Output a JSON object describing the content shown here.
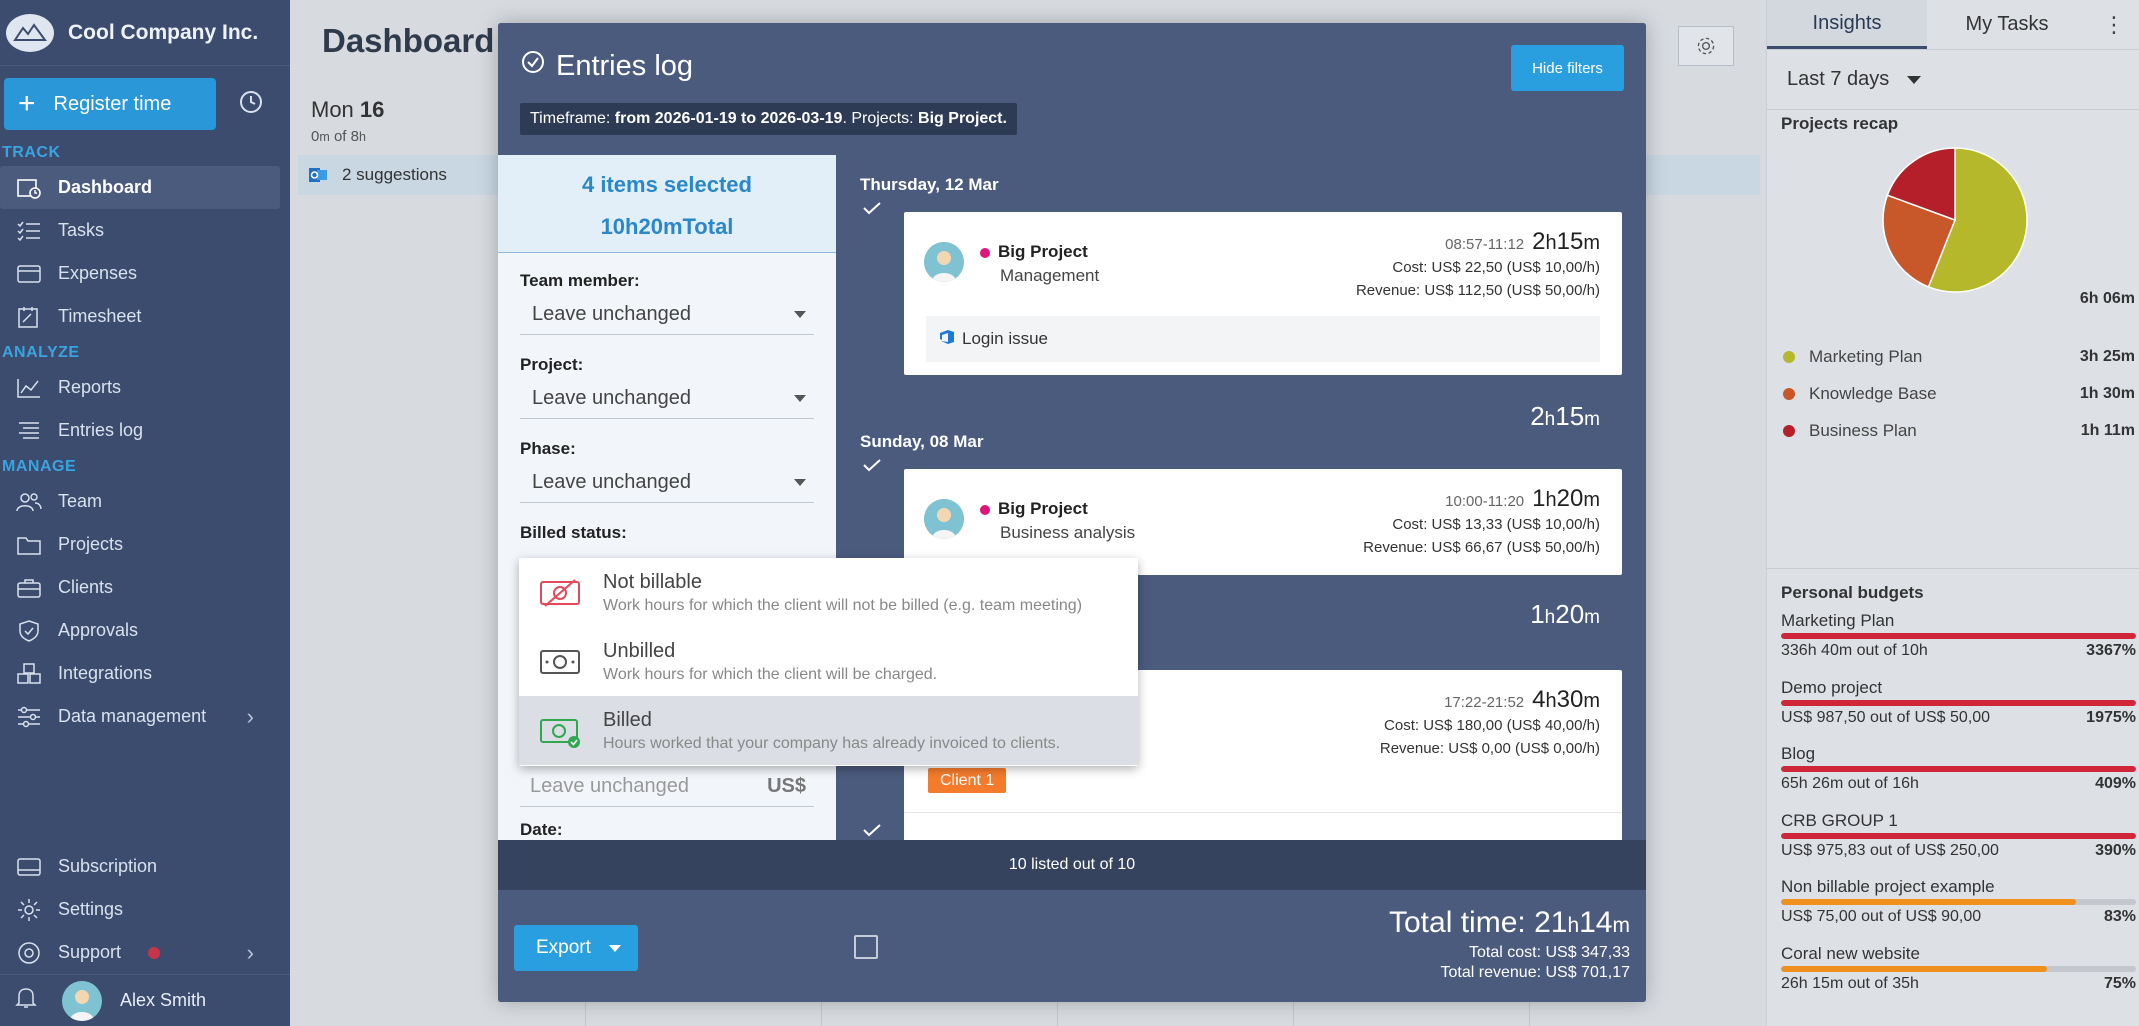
{
  "sidebar": {
    "company": "Cool Company Inc.",
    "register_label": "Register time",
    "sections": {
      "track": "TRACK",
      "analyze": "ANALYZE",
      "manage": "MANAGE"
    },
    "items": {
      "dashboard": "Dashboard",
      "tasks": "Tasks",
      "expenses": "Expenses",
      "timesheet": "Timesheet",
      "reports": "Reports",
      "entries_log": "Entries log",
      "team": "Team",
      "projects": "Projects",
      "clients": "Clients",
      "approvals": "Approvals",
      "integrations": "Integrations",
      "data_management": "Data management",
      "subscription": "Subscription",
      "settings": "Settings",
      "support": "Support"
    },
    "user_name": "Alex Smith"
  },
  "dashboard": {
    "title": "Dashboard",
    "day_name": "Mon",
    "day_num": "16",
    "sub_hours": "0",
    "sub_unit": "m",
    "sub_of": "of 8",
    "sub_h": "h",
    "suggestions": "2 suggestions"
  },
  "right_panel": {
    "tab_insights": "Insights",
    "tab_tasks": "My Tasks",
    "more": "⋮",
    "period": "Last 7 days",
    "recap_title": "Projects recap",
    "recap_total": "6h 06m",
    "recap": [
      {
        "name": "Marketing Plan",
        "value": "3h 25m",
        "color": "#b5b82a",
        "minutes": 205
      },
      {
        "name": "Knowledge Base",
        "value": "1h 30m",
        "color": "#c8582a",
        "minutes": 90
      },
      {
        "name": "Business Plan",
        "value": "1h 11m",
        "color": "#b51f2a",
        "minutes": 71
      }
    ],
    "budgets_title": "Personal budgets",
    "budgets": [
      {
        "name": "Marketing Plan",
        "used": "336h 40m",
        "of": "out of 10h",
        "pct": "3367%",
        "fill": 1.0,
        "color": "#d0263a"
      },
      {
        "name": "Demo project",
        "used": "US$ 987,50",
        "of": "out of US$ 50,00",
        "pct": "1975%",
        "fill": 1.0,
        "color": "#d0263a"
      },
      {
        "name": "Blog",
        "used": "65h 26m",
        "of": "out of 16h",
        "pct": "409%",
        "fill": 1.0,
        "color": "#d0263a"
      },
      {
        "name": "CRB GROUP 1",
        "used": "US$ 975,83",
        "of": "out of US$ 250,00",
        "pct": "390%",
        "fill": 1.0,
        "color": "#d0263a"
      },
      {
        "name": "Non billable project example",
        "used": "US$ 75,00",
        "of": "out of US$ 90,00",
        "pct": "83%",
        "fill": 0.83,
        "color": "#f0901e"
      },
      {
        "name": "Coral new website",
        "used": "26h 15m",
        "of": "out of 35h",
        "pct": "75%",
        "fill": 0.75,
        "color": "#f0901e"
      }
    ]
  },
  "modal": {
    "title": "Entries log",
    "hide_filters": "Hide filters",
    "tf_prefix": "Timeframe:",
    "tf_range": "from 2026-01-19 to 2026-03-19",
    "tf_projects_label": ". Projects:",
    "tf_project": "Big Project.",
    "selected": "4 items selected",
    "selected_total": "10h20mTotal",
    "filters": {
      "team_member_label": "Team member:",
      "team_member_value": "Leave unchanged",
      "project_label": "Project:",
      "project_value": "Leave unchanged",
      "phase_label": "Phase:",
      "phase_value": "Leave unchanged",
      "billed_label": "Billed status:",
      "partial_value": "Leave unchanged",
      "partial_currency": "US$",
      "date_label": "Date:"
    },
    "billed_options": [
      {
        "title": "Not billable",
        "desc": "Work hours for which the client will not be billed (e.g. team meeting)"
      },
      {
        "title": "Unbilled",
        "desc": "Work hours for which the client will be charged."
      },
      {
        "title": "Billed",
        "desc": "Hours worked that your company has already invoiced to clients."
      }
    ],
    "days": [
      {
        "header": "Thursday, 12 Mar",
        "entry": {
          "project": "Big Project",
          "phase": "Management",
          "range": "08:57-11:12",
          "dur_h": "2",
          "dur_m": "15",
          "cost": "Cost: US$ 22,50 (US$ 10,00/h)",
          "revenue": "Revenue: US$ 112,50 (US$ 50,00/h)",
          "note": "Login issue"
        },
        "sum_h": "2",
        "sum_m": "15"
      },
      {
        "header": "Sunday, 08 Mar",
        "entry": {
          "project": "Big Project",
          "phase": "Business analysis",
          "range": "10:00-11:20",
          "dur_h": "1",
          "dur_m": "20",
          "cost": "Cost: US$ 13,33 (US$ 10,00/h)",
          "revenue": "Revenue: US$ 66,67 (US$ 50,00/h)"
        },
        "sum_h": "1",
        "sum_m": "20"
      },
      {
        "entry": {
          "range": "17:22-21:52",
          "dur_h": "4",
          "dur_m": "30",
          "cost": "Cost: US$ 180,00 (US$ 40,00/h)",
          "revenue": "Revenue: US$ 0,00 (US$ 0,00/h)",
          "client": "Client 1"
        }
      }
    ],
    "unit_h": "h",
    "unit_m": "m",
    "count": "10 listed out of 10",
    "export": "Export",
    "total_prefix": "Total time:",
    "total_h": "21",
    "total_m": "14",
    "total_cost": "Total cost: US$ 347,33",
    "total_revenue": "Total revenue: US$ 701,17"
  }
}
